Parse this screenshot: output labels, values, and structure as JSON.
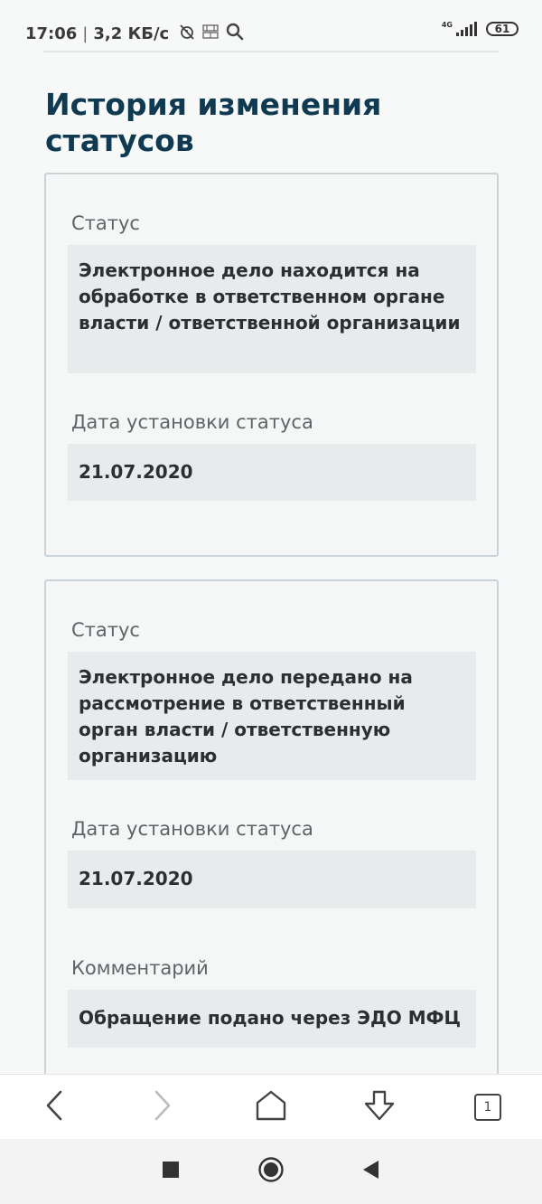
{
  "status_bar": {
    "time": "17:06",
    "separator": "|",
    "net_speed": "3,2 КБ/с",
    "network_type": "4G",
    "battery": "61",
    "icons": [
      "alarm-off-icon",
      "vpn-icon",
      "search-icon",
      "signal-icon",
      "battery-icon"
    ]
  },
  "page": {
    "title": "История изменения статусов"
  },
  "cards": [
    {
      "status_label": "Статус",
      "status_value": "Электронное дело находится на обработке в ответственном органе власти / ответственной организации",
      "date_label": "Дата установки статуса",
      "date_value": "21.07.2020"
    },
    {
      "status_label": "Статус",
      "status_value": "Электронное дело передано на рассмотрение в ответственный орган власти / ответственную организацию",
      "date_label": "Дата установки статуса",
      "date_value": "21.07.2020",
      "comment_label": "Комментарий",
      "comment_value": "Обращение подано через ЭДО МФЦ"
    }
  ],
  "browser_toolbar": {
    "tab_count": "1",
    "icons": [
      "back-icon",
      "forward-icon",
      "home-icon",
      "download-icon",
      "tabs-icon"
    ]
  },
  "nav_bar": {
    "icons": [
      "recents-icon",
      "home-circle-icon",
      "back-triangle-icon"
    ]
  },
  "colors": {
    "title": "#0f3a52",
    "card_border": "#c9d3da",
    "value_bg": "#e8eaec",
    "label": "#5f6368"
  }
}
